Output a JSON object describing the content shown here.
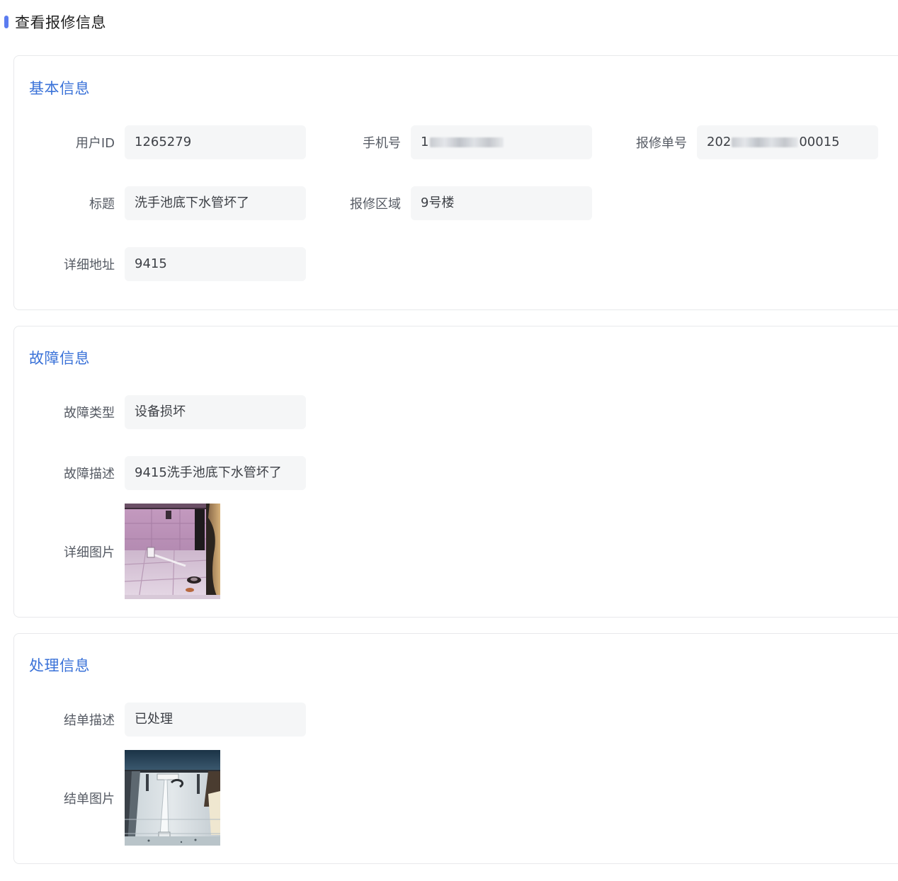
{
  "header": {
    "title": "查看报修信息"
  },
  "basic": {
    "title": "基本信息",
    "user_id_label": "用户ID",
    "user_id_value": "1265279",
    "phone_label": "手机号",
    "phone_value_prefix": "1",
    "order_label": "报修单号",
    "order_value_prefix": "202",
    "order_value_suffix": "00015",
    "title_label": "标题",
    "title_value": "洗手池底下水管坏了",
    "area_label": "报修区域",
    "area_value": "9号楼",
    "address_label": "详细地址",
    "address_value": "9415"
  },
  "fault": {
    "title": "故障信息",
    "type_label": "故障类型",
    "type_value": "设备损坏",
    "desc_label": "故障描述",
    "desc_value": "9415洗手池底下水管坏了",
    "image_label": "详细图片"
  },
  "handle": {
    "title": "处理信息",
    "desc_label": "结单描述",
    "desc_value": "已处理",
    "image_label": "结单图片"
  },
  "colors": {
    "accent": "#3a72d8",
    "header_bar": "#5b7cf0",
    "field_bg": "#f5f6f7"
  },
  "icons": {
    "fault_image": "photo-sink-floor",
    "handle_image": "photo-repaired-pipe"
  }
}
